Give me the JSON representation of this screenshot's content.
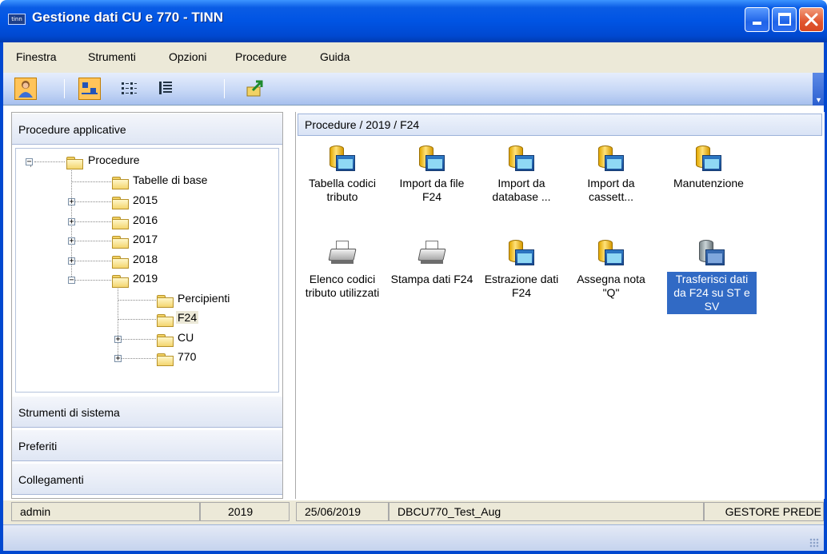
{
  "window": {
    "logo_text": "tinn",
    "title": "Gestione dati CU e 770 - TINN",
    "controls": [
      "minimize",
      "maximize",
      "close"
    ]
  },
  "menu": [
    "Finestra",
    "Strumenti",
    "Opzioni",
    "Procedure",
    "Guida"
  ],
  "toolbar": {
    "buttons": [
      "user-icon",
      "large-icons-view-icon",
      "list-view-icon",
      "details-view-icon",
      "export-icon"
    ]
  },
  "left_panel": {
    "groups": [
      "Procedure applicative",
      "Strumenti di sistema",
      "Preferiti",
      "Collegamenti"
    ],
    "tree": [
      {
        "label": "Procedure",
        "expander": "−"
      },
      {
        "label": "Tabelle di base"
      },
      {
        "label": "2015",
        "expander": "+"
      },
      {
        "label": "2016",
        "expander": "+"
      },
      {
        "label": "2017",
        "expander": "+"
      },
      {
        "label": "2018",
        "expander": "+"
      },
      {
        "label": "2019",
        "expander": "−"
      },
      {
        "label": "Percipienti"
      },
      {
        "label": "F24",
        "selected": true
      },
      {
        "label": "CU",
        "expander": "+"
      },
      {
        "label": "770",
        "expander": "+"
      }
    ]
  },
  "right_panel": {
    "path": "Procedure / 2019 / F24",
    "items": [
      {
        "label": "Tabella codici tributo",
        "icon": "database-window-icon"
      },
      {
        "label": "Import da file F24",
        "icon": "database-window-icon"
      },
      {
        "label": "Import da database ...",
        "icon": "database-window-icon"
      },
      {
        "label": "Import da cassett...",
        "icon": "database-window-icon"
      },
      {
        "label": "Manutenzione",
        "icon": "database-window-icon"
      },
      {
        "label": "Elenco codici tributo utilizzati",
        "icon": "printer-icon"
      },
      {
        "label": "Stampa dati F24",
        "icon": "printer-icon"
      },
      {
        "label": "Estrazione dati F24",
        "icon": "database-window-icon"
      },
      {
        "label": "Assegna nota \"Q\"",
        "icon": "database-window-icon"
      },
      {
        "label": "Trasferisci dati da F24 su ST e SV",
        "icon": "database-transfer-icon",
        "selected": true
      }
    ]
  },
  "status": {
    "user": "admin",
    "year": "2019",
    "date": "25/06/2019",
    "database": "DBCU770_Test_Aug",
    "role": "GESTORE PREDE"
  },
  "colors": {
    "title_bar": "#0054e3",
    "selection": "#316ac5",
    "toolbar_active": "#ffc45a"
  }
}
